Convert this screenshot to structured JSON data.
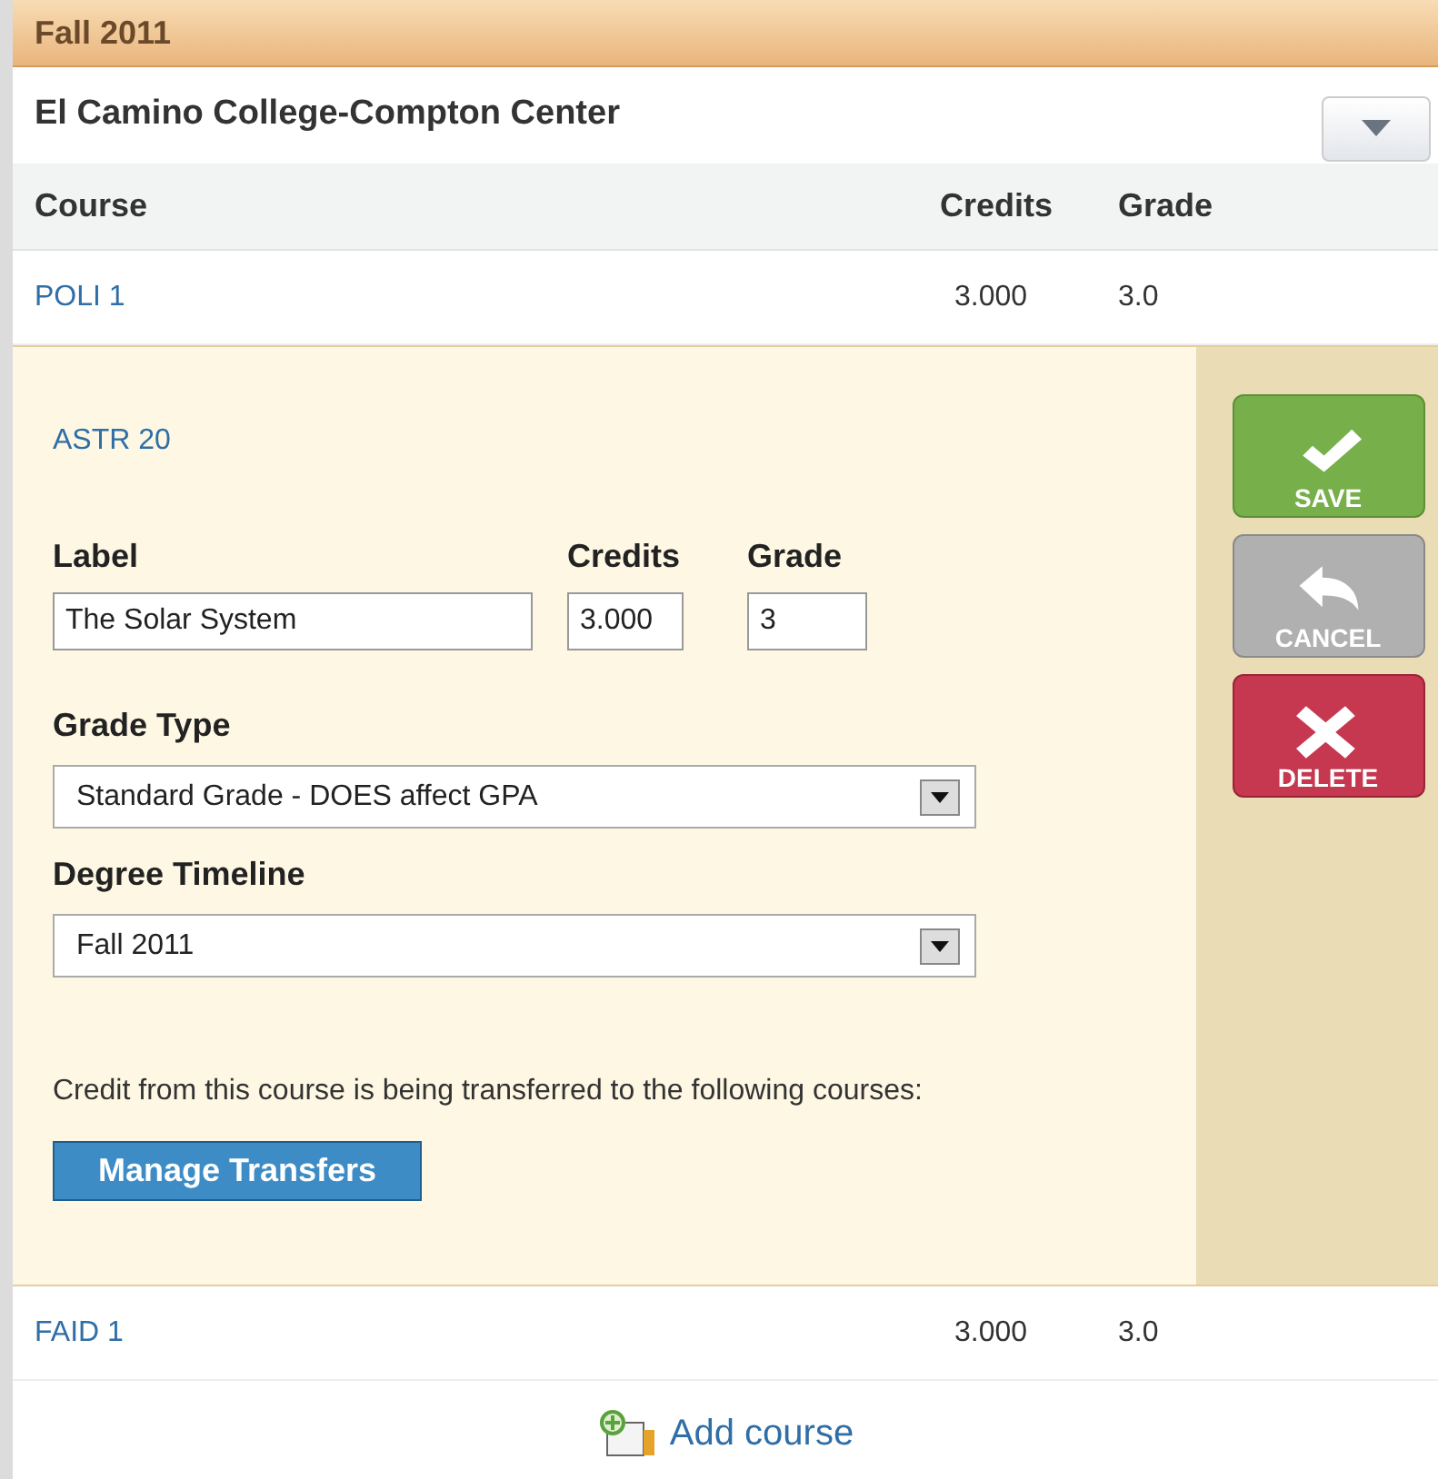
{
  "term": "Fall 2011",
  "institution": "El Camino College-Compton Center",
  "columns": [
    "Course",
    "Credits",
    "Grade"
  ],
  "courses": [
    {
      "kind": "row",
      "code": "POLI 1",
      "credits": "3.000",
      "grade": "3.0"
    },
    {
      "kind": "editor",
      "code": "ASTR 20",
      "fields": {
        "label": {
          "label": "Label",
          "value": "The Solar System"
        },
        "credits": {
          "label": "Credits",
          "value": "3.000"
        },
        "grade": {
          "label": "Grade",
          "value": "3"
        }
      },
      "grade_type": {
        "label": "Grade Type",
        "value": "Standard Grade - DOES affect GPA"
      },
      "degree_timeline": {
        "label": "Degree Timeline",
        "value": "Fall 2011"
      },
      "transfer_note": "Credit from this course is being transferred to the following courses:",
      "manage_button": "Manage Transfers",
      "actions": [
        {
          "kind": "save",
          "label": "SAVE"
        },
        {
          "kind": "cancel",
          "label": "CANCEL"
        },
        {
          "kind": "delete",
          "label": "DELETE"
        }
      ]
    },
    {
      "kind": "row",
      "code": "FAID 1",
      "credits": "3.000",
      "grade": "3.0"
    }
  ],
  "add_course": "Add course"
}
